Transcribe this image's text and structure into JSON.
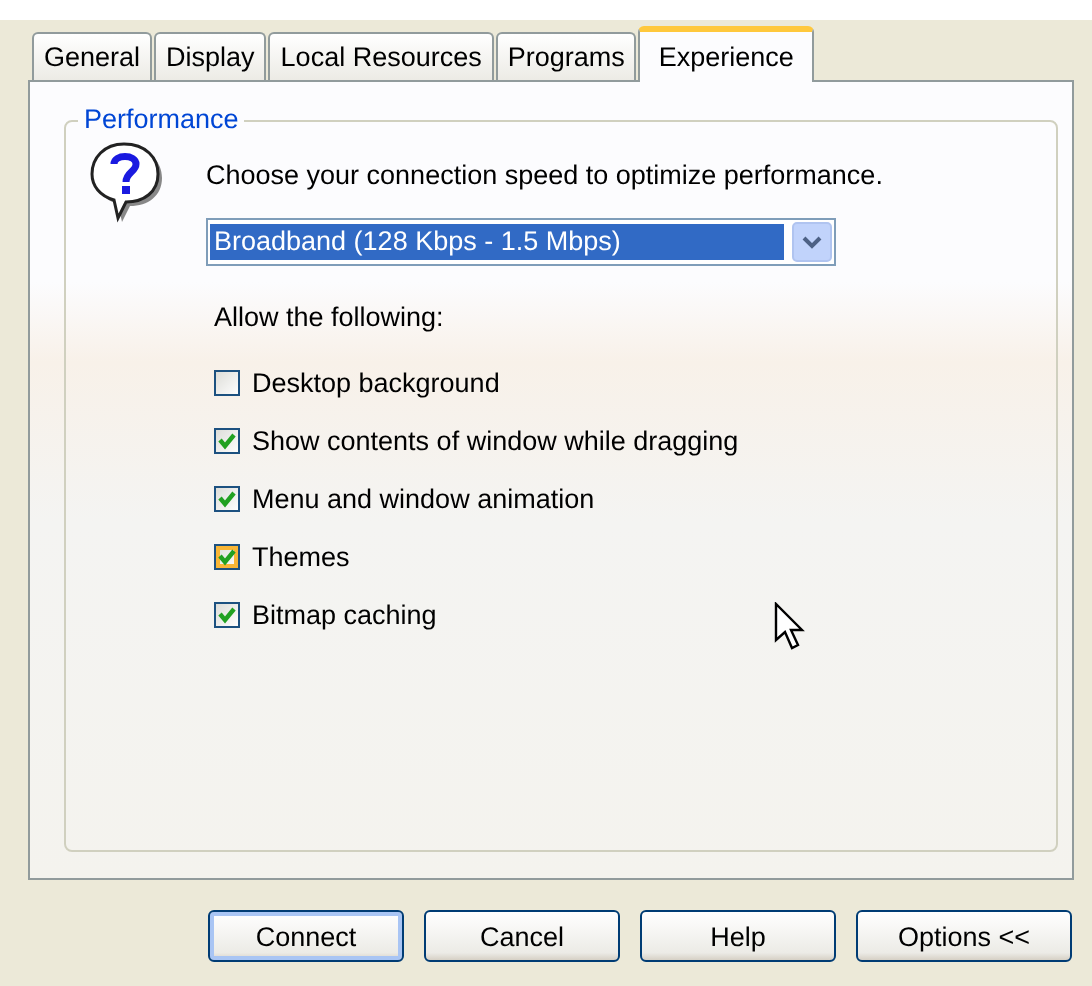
{
  "tabs": [
    {
      "label": "General",
      "selected": false
    },
    {
      "label": "Display",
      "selected": false
    },
    {
      "label": "Local Resources",
      "selected": false
    },
    {
      "label": "Programs",
      "selected": false
    },
    {
      "label": "Experience",
      "selected": true
    }
  ],
  "group": {
    "title": "Performance",
    "prompt": "Choose your connection speed to optimize performance.",
    "speed": {
      "value": "Broadband (128 Kbps - 1.5 Mbps)"
    },
    "allow_label": "Allow the following:",
    "options": [
      {
        "label": "Desktop background",
        "checked": false,
        "hovered": false
      },
      {
        "label": "Show contents of window while dragging",
        "checked": true,
        "hovered": false
      },
      {
        "label": "Menu and window animation",
        "checked": true,
        "hovered": false
      },
      {
        "label": "Themes",
        "checked": true,
        "hovered": true
      },
      {
        "label": "Bitmap caching",
        "checked": true,
        "hovered": false
      }
    ]
  },
  "buttons": [
    {
      "label": "Connect",
      "default": true
    },
    {
      "label": "Cancel",
      "default": false
    },
    {
      "label": "Help",
      "default": false
    },
    {
      "label": "Options <<",
      "default": false
    }
  ]
}
